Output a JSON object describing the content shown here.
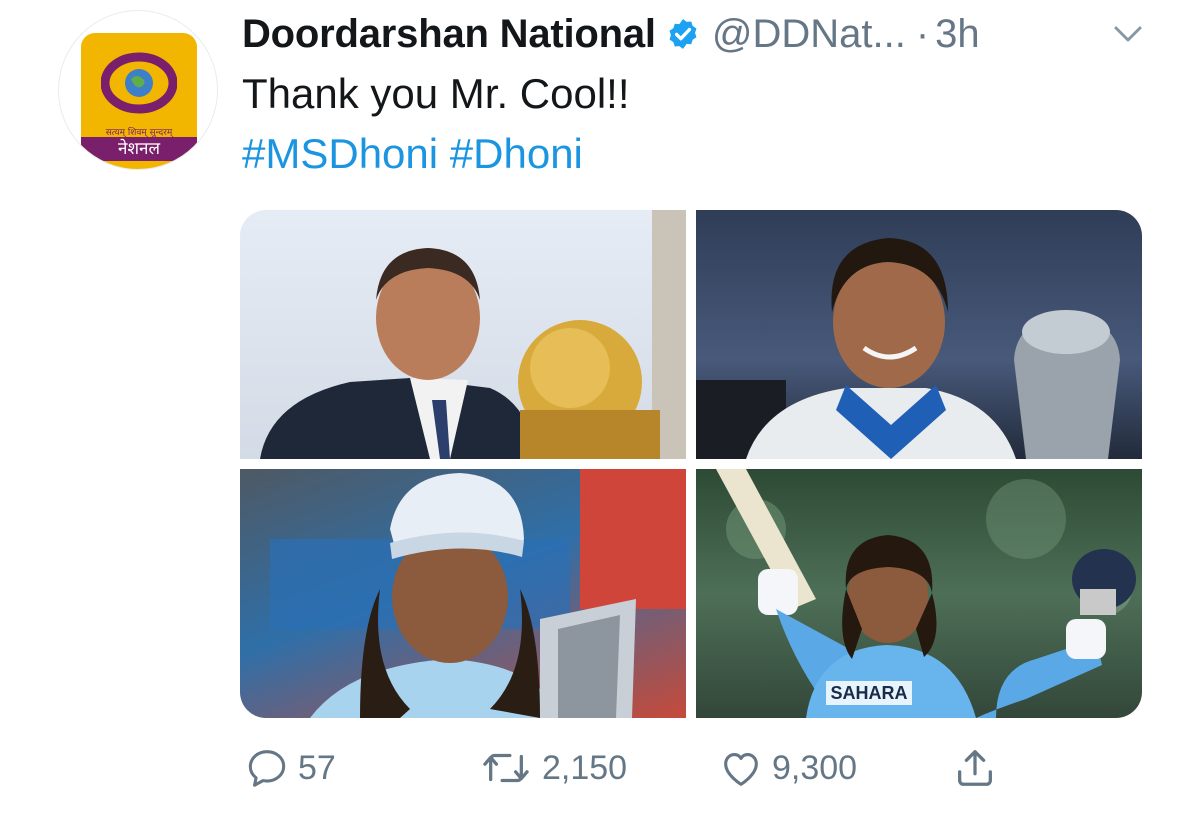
{
  "account": {
    "name": "Doordarshan National",
    "handle": "@DDNat...",
    "separator": "·",
    "time": "3h",
    "avatar": {
      "tagline": "सत्यम् शिवम् सुन्दरम्",
      "label": "नेशनल"
    }
  },
  "tweet": {
    "text": "Thank you Mr. Cool!!",
    "hashtags": [
      "#MSDhoni",
      "#Dhoni"
    ]
  },
  "media": {
    "photos": [
      {
        "name": "photo-dhoni-world-cup-trophy"
      },
      {
        "name": "photo-dhoni-champions-trophy"
      },
      {
        "name": "photo-dhoni-t20-trophy"
      },
      {
        "name": "photo-dhoni-raising-bat"
      }
    ],
    "jersey_text": "SAHARA"
  },
  "actions": {
    "replies": "57",
    "retweets": "2,150",
    "likes": "9,300"
  },
  "colors": {
    "text": "#14171a",
    "secondary": "#657786",
    "link": "#1b95e0",
    "verified": "#1da1f2",
    "logo_yellow": "#f2b600",
    "logo_purple": "#7a1f6b"
  },
  "icons": {
    "verified": "verified-badge-icon",
    "caret": "chevron-down-icon",
    "reply": "reply-icon",
    "retweet": "retweet-icon",
    "like": "heart-icon",
    "share": "share-icon"
  }
}
